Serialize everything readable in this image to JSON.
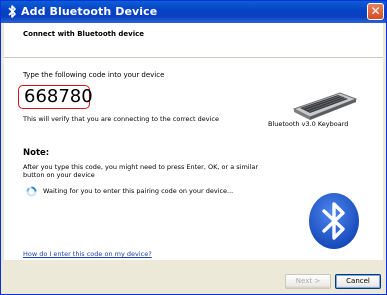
{
  "window": {
    "title": "Add Bluetooth Device",
    "close_glyph": "✕"
  },
  "header": {
    "subtitle": "Connect with Bluetooth device"
  },
  "pairing": {
    "instruction": "Type the following code into your device",
    "code": "668780",
    "verify_text": "This will verify that you are connecting to the correct device"
  },
  "device": {
    "name": "Bluetooth v3.0 Keyboard",
    "icon": "keyboard-icon"
  },
  "note": {
    "title": "Note:",
    "body": "After you type this code, you might need to press Enter, OK, or a similar button on your device",
    "status": "Waiting for you to enter this pairing code on your device..."
  },
  "help": {
    "link_text": "How do I enter this code on my device?"
  },
  "buttons": {
    "next": "Next >",
    "cancel": "Cancel"
  },
  "colors": {
    "title_bar": "#0843c5",
    "code_outline": "#d0161b",
    "bluetooth_blue": "#1f5ad8"
  }
}
